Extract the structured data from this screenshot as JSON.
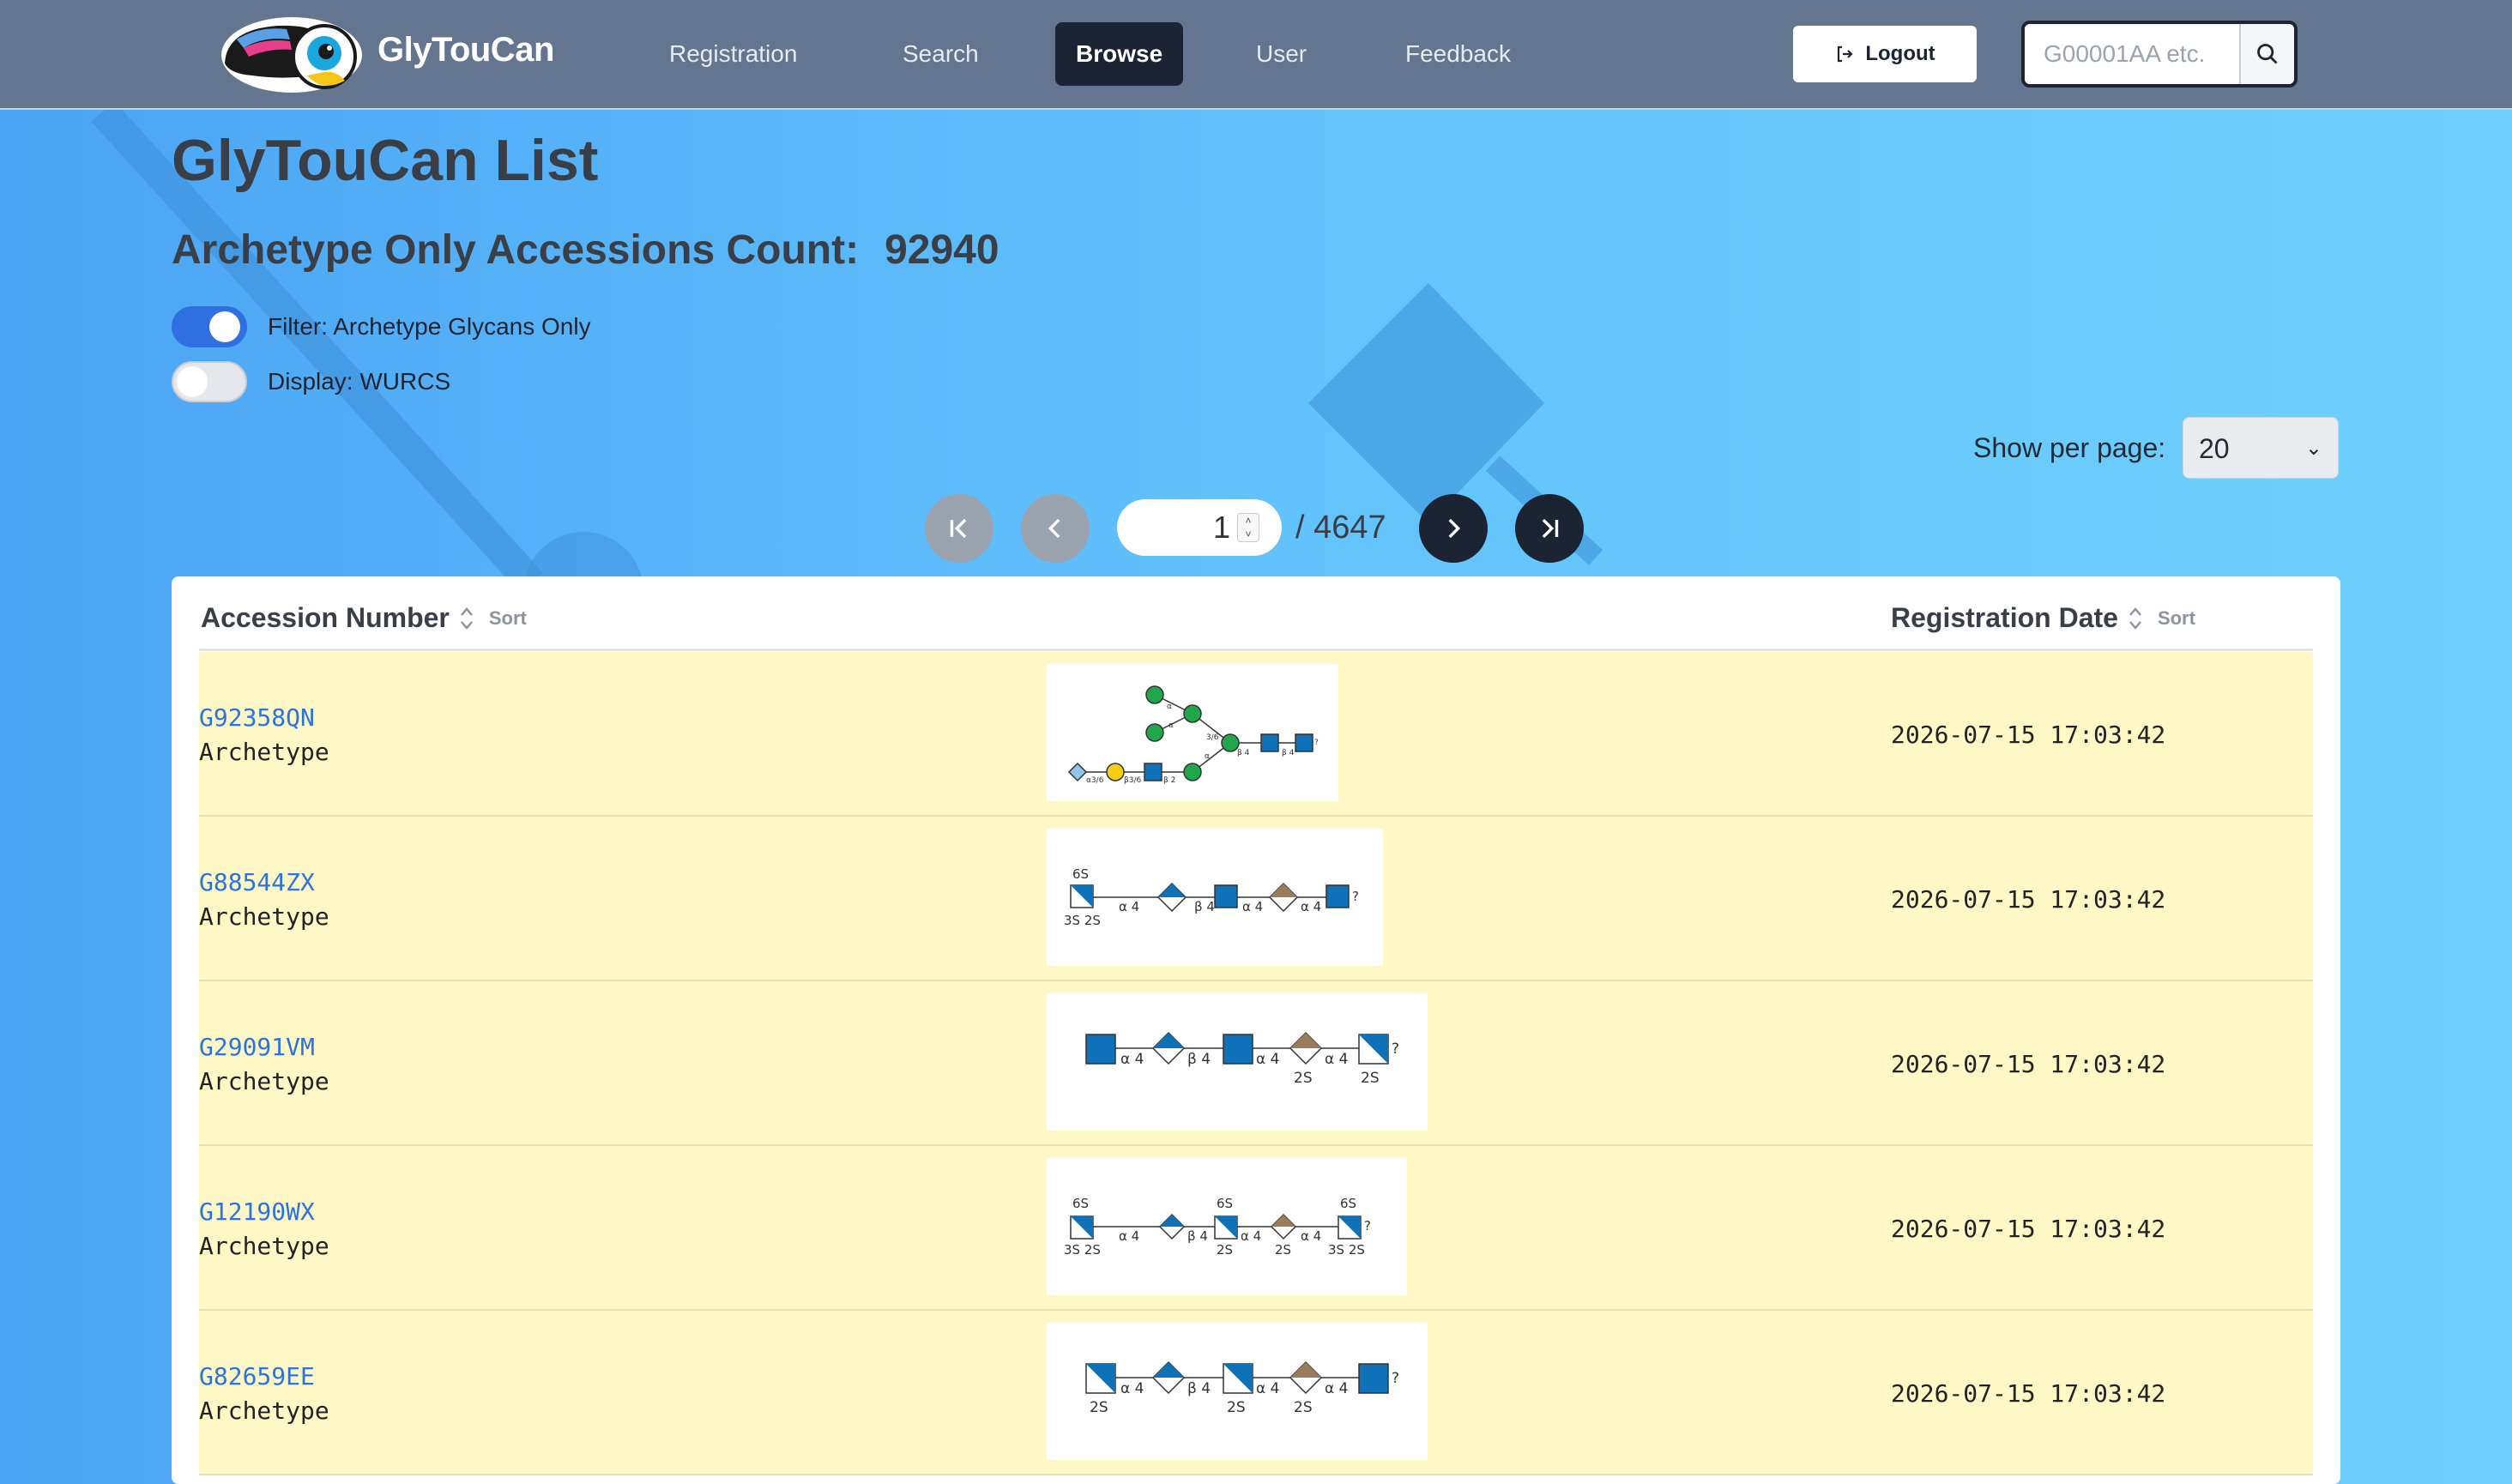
{
  "header": {
    "brand": "GlyTouCan",
    "nav": [
      {
        "label": "Registration"
      },
      {
        "label": "Search"
      },
      {
        "label": "Browse"
      },
      {
        "label": "User"
      },
      {
        "label": "Feedback"
      }
    ],
    "active_nav": "Browse",
    "logout_label": "Logout",
    "search_placeholder": "G00001AA etc."
  },
  "page": {
    "title": "GlyTouCan List",
    "count_label": "Archetype Only Accessions Count:",
    "count_value": "92940"
  },
  "toggles": [
    {
      "label": "Filter: Archetype Glycans Only",
      "on": true
    },
    {
      "label": "Display: WURCS",
      "on": false
    }
  ],
  "per_page": {
    "label": "Show per page:",
    "value": "20"
  },
  "pagination": {
    "current": "1",
    "total": "/ 4647"
  },
  "table": {
    "col_accession": "Accession Number",
    "col_date": "Registration Date",
    "sort_label": "Sort",
    "rows": [
      {
        "accession": "G92358QN",
        "type": "Archetype",
        "date": "2026-07-15 17:03:42"
      },
      {
        "accession": "G88544ZX",
        "type": "Archetype",
        "date": "2026-07-15 17:03:42"
      },
      {
        "accession": "G29091VM",
        "type": "Archetype",
        "date": "2026-07-15 17:03:42"
      },
      {
        "accession": "G12190WX",
        "type": "Archetype",
        "date": "2026-07-15 17:03:42"
      },
      {
        "accession": "G82659EE",
        "type": "Archetype",
        "date": "2026-07-15 17:03:42"
      }
    ]
  },
  "glycan_labels": {
    "r2": {
      "top": "6S",
      "bottom": "3S 2S",
      "links": [
        "α 4",
        "β 4",
        "α 4",
        "α 4"
      ],
      "end": "?"
    },
    "r3": {
      "links": [
        "α 4",
        "β 4",
        "α 4",
        "α 4"
      ],
      "bottom": [
        "2S",
        "2S"
      ],
      "end": "?"
    },
    "r4": {
      "tops": [
        "6S",
        "6S",
        "6S"
      ],
      "bottoms": [
        "3S 2S",
        "2S",
        "2S",
        "3S 2S"
      ],
      "links": [
        "α 4",
        "β 4",
        "α 4",
        "α 4"
      ],
      "end": "?"
    },
    "r5": {
      "bottoms": [
        "2S",
        "2S",
        "2S"
      ],
      "links": [
        "α 4",
        "β 4",
        "α 4",
        "α 4"
      ],
      "end": "?"
    },
    "r1": {
      "links": [
        "α",
        "α",
        "3/6",
        "β 4",
        "β 4",
        "α3/6",
        "β3/6",
        "β 2",
        "α"
      ],
      "end": "?"
    }
  },
  "colors": {
    "header_bg": "#647590",
    "accent_dark": "#1c2333",
    "link": "#2b73dd",
    "row_bg": "#fdf8c6",
    "glcnac_blue": "#0f72b9",
    "man_green": "#22a64b",
    "gal_yellow": "#f5cf14",
    "hexa_brown": "#9b7c5a"
  }
}
